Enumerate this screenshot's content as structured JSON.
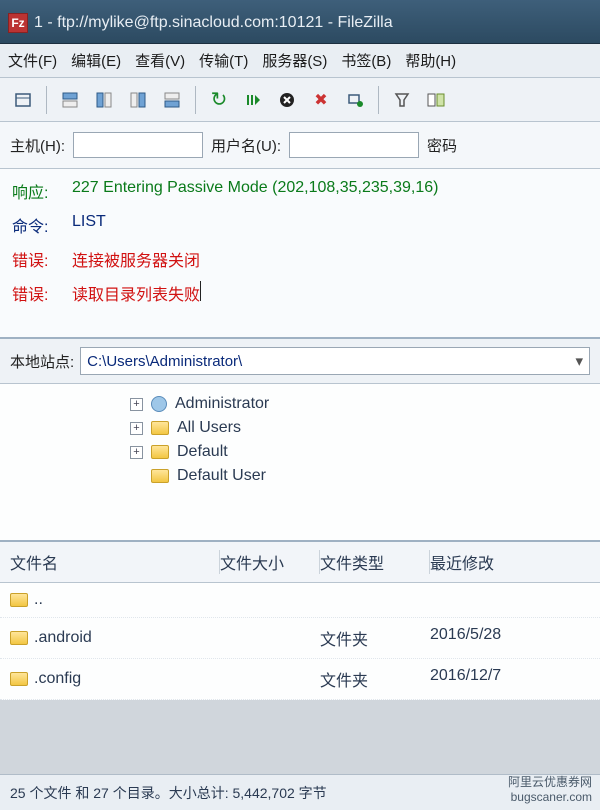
{
  "title": "1 - ftp://mylike@ftp.sinacloud.com:10121 - FileZilla",
  "menu": {
    "file": "文件(F)",
    "edit": "编辑(E)",
    "view": "查看(V)",
    "transfer": "传输(T)",
    "server": "服务器(S)",
    "bookmarks": "书签(B)",
    "help": "帮助(H)"
  },
  "quick": {
    "host_label": "主机(H):",
    "user_label": "用户名(U):",
    "pass_label": "密码"
  },
  "log": [
    {
      "label": "响应:",
      "text": "227 Entering Passive Mode (202,108,35,235,39,16)",
      "cls": "c-green"
    },
    {
      "label": "命令:",
      "text": "LIST",
      "cls": "c-blue"
    },
    {
      "label": "错误:",
      "text": "连接被服务器关闭",
      "cls": "c-red"
    },
    {
      "label": "错误:",
      "text": "读取目录列表失败",
      "cls": "c-red"
    }
  ],
  "local": {
    "label": "本地站点:",
    "path": "C:\\Users\\Administrator\\"
  },
  "tree": [
    {
      "name": "Administrator",
      "icon": "user"
    },
    {
      "name": "All Users",
      "icon": "folder"
    },
    {
      "name": "Default",
      "icon": "folder"
    },
    {
      "name": "Default User",
      "icon": "folder",
      "expander": false
    }
  ],
  "filelist": {
    "headers": {
      "name": "文件名",
      "size": "文件大小",
      "type": "文件类型",
      "date": "最近修改"
    },
    "rows": [
      {
        "name": "..",
        "size": "",
        "type": "",
        "date": ""
      },
      {
        "name": ".android",
        "size": "",
        "type": "文件夹",
        "date": "2016/5/28"
      },
      {
        "name": ".config",
        "size": "",
        "type": "文件夹",
        "date": "2016/12/7"
      }
    ]
  },
  "status": "25 个文件 和 27 个目录。大小总计: 5,442,702 字节",
  "watermark": {
    "line1": "阿里云优惠券网",
    "line2": "bugscaner.com"
  }
}
